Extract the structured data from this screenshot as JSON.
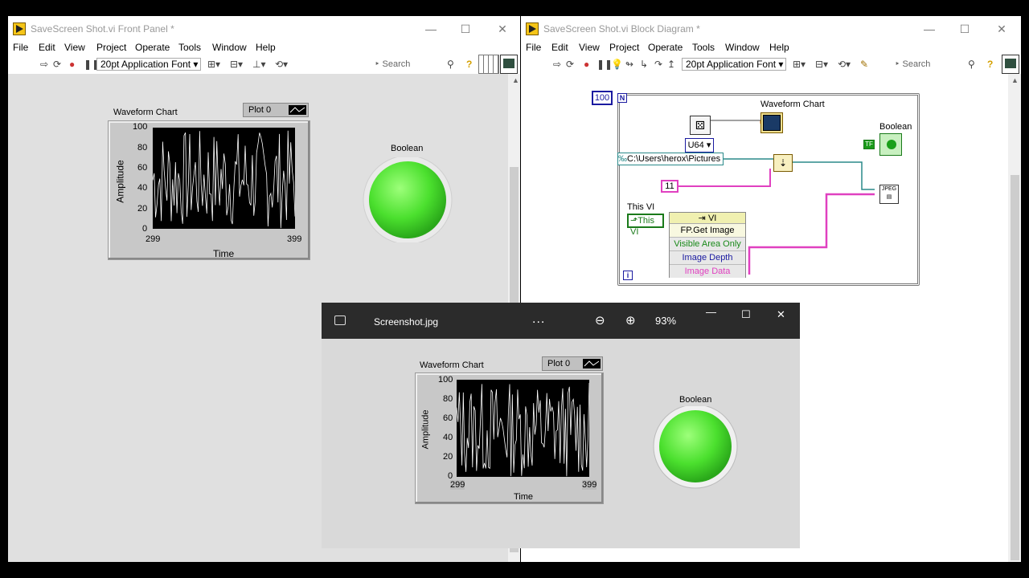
{
  "front_panel": {
    "title": "SaveScreen Shot.vi Front Panel *",
    "menu": [
      "File",
      "Edit",
      "View",
      "Project",
      "Operate",
      "Tools",
      "Window",
      "Help"
    ],
    "font": "20pt Application Font",
    "search_placeholder": "Search",
    "chart": {
      "label": "Waveform Chart",
      "legend": "Plot 0",
      "ylabel": "Amplitude",
      "xlabel": "Time",
      "yticks": [
        "100",
        "80",
        "60",
        "40",
        "20",
        "0"
      ],
      "xmin": "299",
      "xmax": "399"
    },
    "boolean_label": "Boolean"
  },
  "block_diagram": {
    "title": "SaveScreen Shot.vi Block Diagram *",
    "menu": [
      "File",
      "Edit",
      "View",
      "Project",
      "Operate",
      "Tools",
      "Window",
      "Help"
    ],
    "font": "20pt Application Font",
    "search_placeholder": "Search",
    "loop_count": "100",
    "loop_n": "N",
    "loop_i": "i",
    "chart_label": "Waveform Chart",
    "boolean_label": "Boolean",
    "boolean_const": "TF",
    "u64": "U64",
    "path_const": "C:\\Users\\herox\\Pictures",
    "num_const": "11",
    "this_vi_label": "This VI",
    "this_vi_ref": "This VI",
    "property_node": {
      "class": "VI",
      "method": "FP.Get Image",
      "params": [
        "Visible Area Only",
        "Image Depth",
        "Image Data"
      ]
    },
    "jpeg_icon": "JPEG"
  },
  "photo_viewer": {
    "filename": "Screenshot.jpg",
    "more": "...",
    "zoom": "93%",
    "chart": {
      "label": "Waveform Chart",
      "legend": "Plot 0",
      "ylabel": "Amplitude",
      "xlabel": "Time",
      "yticks": [
        "100",
        "80",
        "60",
        "40",
        "20",
        "0"
      ],
      "xmin": "299",
      "xmax": "399"
    },
    "boolean_label": "Boolean"
  },
  "colors": {
    "led_green": "#4be02e",
    "pink_wire": "#e040c0",
    "teal_wire": "#2a8a8a",
    "blue_border": "#1a1aa0"
  }
}
